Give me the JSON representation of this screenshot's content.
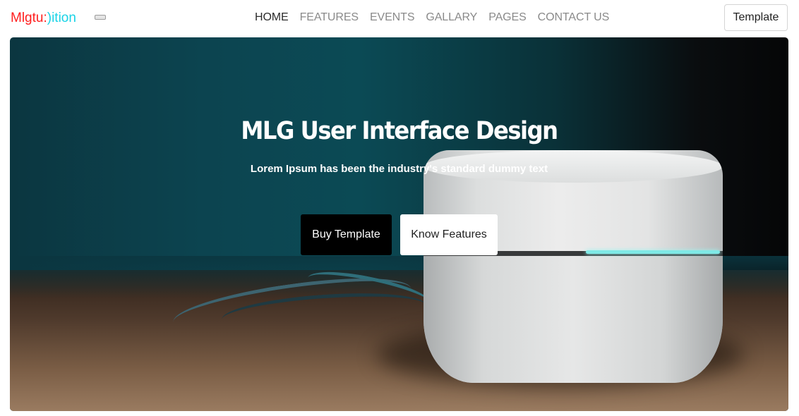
{
  "brand": {
    "part1": "Mlgtu:",
    "part2": ")ition",
    "color1": "#ff1e1e",
    "color2": "#19d3e6"
  },
  "nav": {
    "items": [
      {
        "label": "HOME",
        "active": true
      },
      {
        "label": "FEATURES",
        "active": false
      },
      {
        "label": "EVENTS",
        "active": false
      },
      {
        "label": "GALLARY",
        "active": false
      },
      {
        "label": "PAGES",
        "active": false
      },
      {
        "label": "CONTACT US",
        "active": false
      }
    ],
    "toggler_icon": "menu-toggle-icon",
    "cta_label": "Template"
  },
  "hero": {
    "title": "MLG User Interface Design",
    "subtitle": "Lorem Ipsum has been the industry's standard dummy text",
    "primary_button": "Buy Template",
    "secondary_button": "Know Features",
    "image": "white-wifi-router-photo"
  }
}
